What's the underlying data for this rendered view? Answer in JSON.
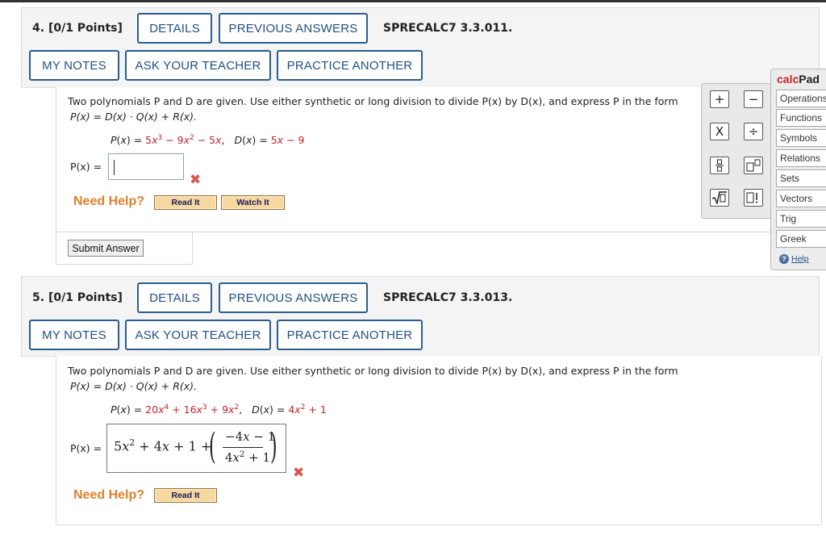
{
  "questions": [
    {
      "number": "4.",
      "points": "[0/1 Points]",
      "details_label": "DETAILS",
      "previous_answers_label": "PREVIOUS ANSWERS",
      "code": "SPRECALC7 3.3.011.",
      "my_notes_label": "MY NOTES",
      "ask_teacher_label": "ASK YOUR TEACHER",
      "practice_another_label": "PRACTICE ANOTHER",
      "prompt_line1": "Two polynomials P and D are given. Use either synthetic or long division to divide P(x) by D(x), and express P in the form",
      "prompt_line2": "P(x) = D(x) · Q(x) + R(x).",
      "answer_label": "P(x) =",
      "answer_value": "",
      "result_mark": "✖",
      "need_help": "Need Help?",
      "read_it": "Read It",
      "watch_it": "Watch It",
      "submit_label": "Submit Answer"
    },
    {
      "number": "5.",
      "points": "[0/1 Points]",
      "details_label": "DETAILS",
      "previous_answers_label": "PREVIOUS ANSWERS",
      "code": "SPRECALC7 3.3.013.",
      "my_notes_label": "MY NOTES",
      "ask_teacher_label": "ASK YOUR TEACHER",
      "practice_another_label": "PRACTICE ANOTHER",
      "prompt_line1": "Two polynomials P and D are given. Use either synthetic or long division to divide P(x) by D(x), and express P in the form",
      "prompt_line2": "P(x) = D(x) · Q(x) + R(x).",
      "answer_label": "P(x) =",
      "result_mark": "✖",
      "need_help": "Need Help?",
      "read_it": "Read It"
    }
  ],
  "calcpad": {
    "title_part1": "calc",
    "title_part2": "Pad",
    "items": [
      "Operations",
      "Functions",
      "Symbols",
      "Relations",
      "Sets",
      "Vectors",
      "Trig",
      "Greek"
    ],
    "help": "Help"
  },
  "colors": {
    "accent": "#2a5d8f",
    "given_red": "#c0262c",
    "need_help_orange": "#e0812a",
    "panel_bg": "#f4f4f4"
  }
}
